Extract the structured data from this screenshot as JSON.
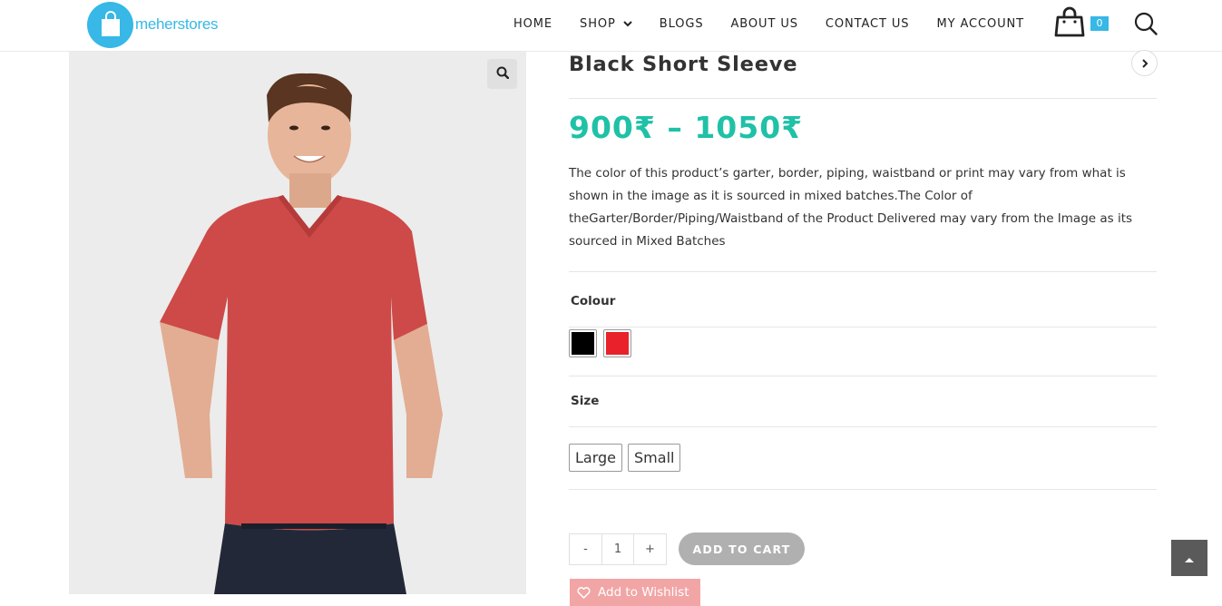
{
  "brand": {
    "logo_text": "meherstores"
  },
  "nav": {
    "items": [
      {
        "label": "HOME"
      },
      {
        "label": "SHOP"
      },
      {
        "label": "BLOGS"
      },
      {
        "label": "ABOUT US"
      },
      {
        "label": "CONTACT US"
      },
      {
        "label": "MY ACCOUNT"
      }
    ],
    "cart_count": "0"
  },
  "product": {
    "title": "Black Short Sleeve",
    "price": "900₹ – 1050₹",
    "description": "The color of this product’s garter, border, piping, waistband or print may vary from what is shown in the image as it is sourced in mixed batches.The Color of theGarter/Border/Piping/Waistband of the Product Delivered may vary from the Image as its sourced in Mixed Batches",
    "colour_label": "Colour",
    "colours": [
      {
        "name": "black",
        "hex": "#000000"
      },
      {
        "name": "red",
        "hex": "#e8212a"
      }
    ],
    "size_label": "Size",
    "sizes": [
      "Large",
      "Small"
    ],
    "qty_minus": "-",
    "qty_value": "1",
    "qty_plus": "+",
    "add_to_cart": "ADD TO CART",
    "wishlist": "Add to Wishlist"
  },
  "colors": {
    "accent": "#37b8e6",
    "price": "#1fc1a7",
    "button_disabled": "#b0b0b0",
    "wishlist": "#f2a5a5"
  }
}
